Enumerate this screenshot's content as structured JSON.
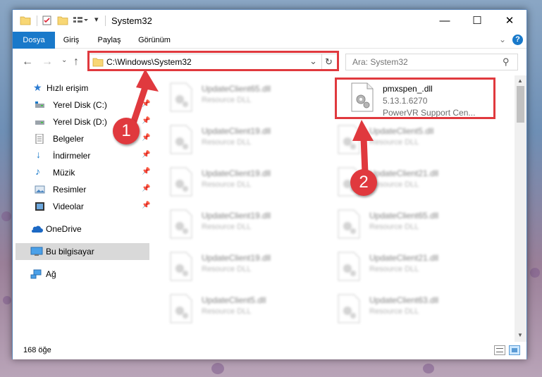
{
  "window": {
    "title": "System32"
  },
  "ribbon": {
    "tabs": [
      {
        "label": "Dosya",
        "active": true
      },
      {
        "label": "Giriş"
      },
      {
        "label": "Paylaş"
      },
      {
        "label": "Görünüm"
      }
    ]
  },
  "address": {
    "path": "C:\\Windows\\System32"
  },
  "search": {
    "placeholder": "Ara: System32"
  },
  "sidebar": {
    "items": [
      {
        "label": "Hızlı erişim",
        "icon": "star-icon"
      },
      {
        "label": "Yerel Disk (C:)",
        "icon": "drive-icon",
        "pinned": true
      },
      {
        "label": "Yerel Disk (D:)",
        "icon": "drive-icon",
        "pinned": true
      },
      {
        "label": "Belgeler",
        "icon": "documents-icon",
        "pinned": true
      },
      {
        "label": "İndirmeler",
        "icon": "download-icon",
        "pinned": true
      },
      {
        "label": "Müzik",
        "icon": "music-icon",
        "pinned": true
      },
      {
        "label": "Resimler",
        "icon": "pictures-icon",
        "pinned": true
      },
      {
        "label": "Videolar",
        "icon": "video-icon",
        "pinned": true
      },
      {
        "label": "OneDrive",
        "icon": "cloud-icon"
      },
      {
        "label": "Bu bilgisayar",
        "icon": "computer-icon",
        "selected": true
      },
      {
        "label": "Ağ",
        "icon": "network-icon"
      }
    ]
  },
  "files": {
    "highlighted": {
      "name": "pmxspen_.dll",
      "version": "5.13.1.6270",
      "description": "PowerVR Support Cen..."
    },
    "left_column": [
      {
        "name": "UpdateClient65.dll",
        "type": "Resource DLL"
      },
      {
        "name": "UpdateClient19.dll",
        "type": "Resource DLL"
      },
      {
        "name": "UpdateClient19.dll",
        "type": "Resource DLL"
      },
      {
        "name": "UpdateClient19.dll",
        "type": "Resource DLL"
      },
      {
        "name": "UpdateClient19.dll",
        "type": "Resource DLL"
      },
      {
        "name": "UpdateClient5.dll",
        "type": "Resource DLL"
      }
    ],
    "right_column": [
      {
        "name": "UpdateClient5.dll",
        "type": "Resource DLL"
      },
      {
        "name": "UpdateClient21.dll",
        "type": "Resource DLL"
      },
      {
        "name": "UpdateClient65.dll",
        "type": "Resource DLL"
      },
      {
        "name": "UpdateClient21.dll",
        "type": "Resource DLL"
      },
      {
        "name": "UpdateClient63.dll",
        "type": "Resource DLL"
      }
    ]
  },
  "status": {
    "item_count": "168 öğe"
  },
  "callouts": [
    {
      "label": "1"
    },
    {
      "label": "2"
    }
  ],
  "colors": {
    "accent": "#1979ca",
    "highlight": "#e0393e",
    "folder": "#f8d775"
  }
}
